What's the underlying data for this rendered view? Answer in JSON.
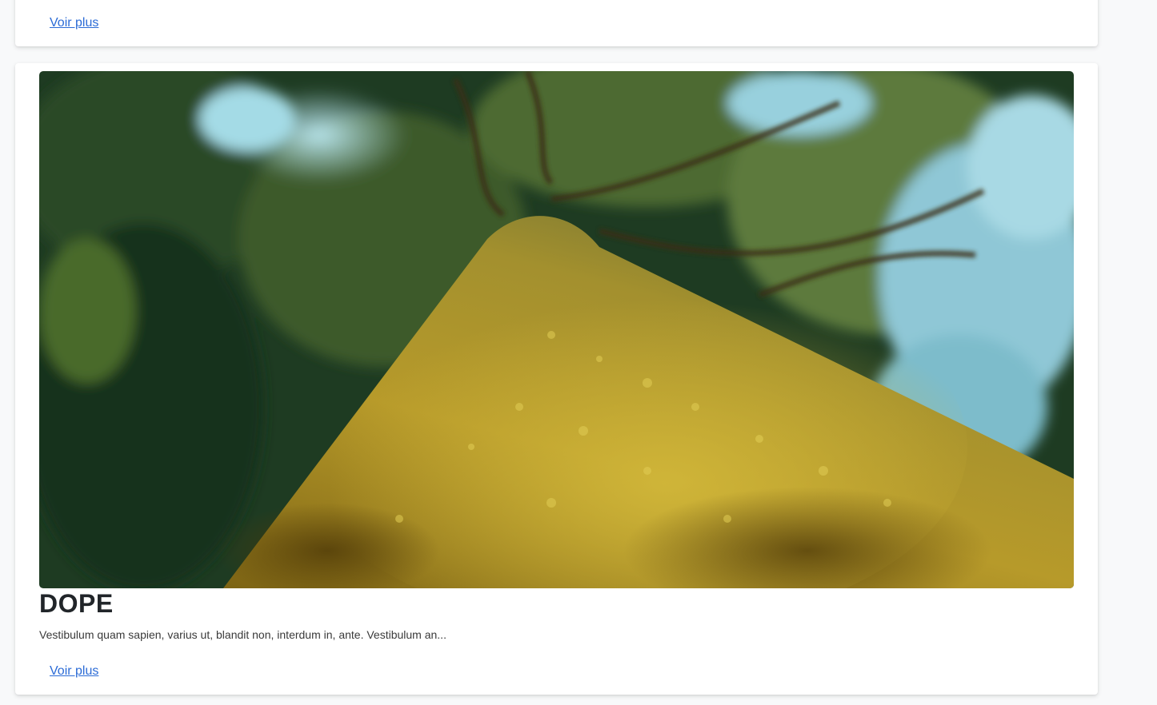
{
  "cards": [
    {
      "link_label": "Voir plus"
    },
    {
      "image_alt": "mossy-tree-trunk-photo",
      "title": "DOPE",
      "excerpt": "Vestibulum quam sapien, varius ut, blandit non, interdum in, ante. Vestibulum an...",
      "link_label": "Voir plus"
    }
  ],
  "colors": {
    "link": "#2b6bd6",
    "title": "#212529",
    "card_background": "#ffffff",
    "page_background": "#f8f9fa"
  }
}
